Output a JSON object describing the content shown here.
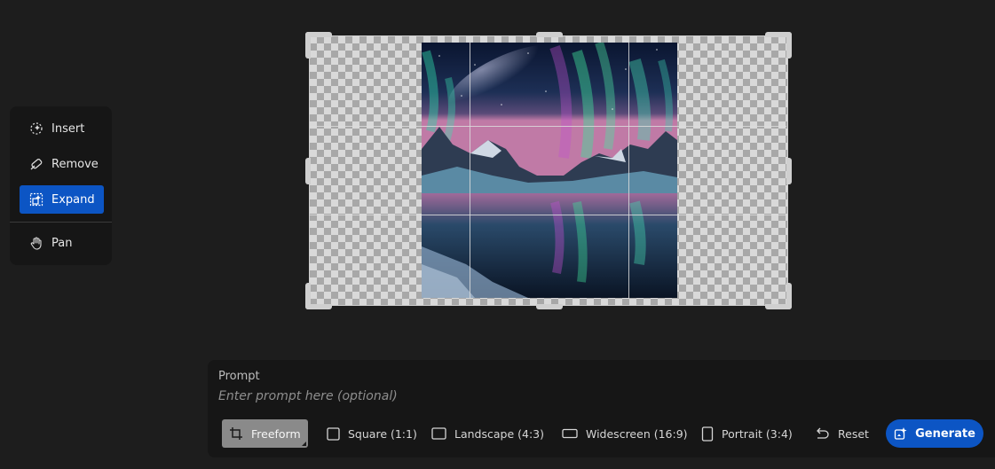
{
  "tools": [
    {
      "label": "Insert",
      "icon": "insert-icon"
    },
    {
      "label": "Remove",
      "icon": "remove-icon"
    },
    {
      "label": "Expand",
      "icon": "expand-icon",
      "active": true
    },
    {
      "label": "Pan",
      "icon": "hand-icon"
    }
  ],
  "prompt": {
    "label": "Prompt",
    "placeholder": "Enter prompt here (optional)"
  },
  "aspect_options": [
    {
      "label": "Freeform",
      "icon": "crop-icon",
      "selected": true
    },
    {
      "label": "Square (1:1)",
      "icon": "square-icon"
    },
    {
      "label": "Landscape (4:3)",
      "icon": "landscape-icon"
    },
    {
      "label": "Widescreen (16:9)",
      "icon": "widescreen-icon"
    },
    {
      "label": "Portrait (3:4)",
      "icon": "portrait-icon"
    }
  ],
  "reset_label": "Reset",
  "generate_label": "Generate",
  "colors": {
    "accent": "#0c55c4",
    "background": "#1d1d1d",
    "panel": "#161616"
  }
}
